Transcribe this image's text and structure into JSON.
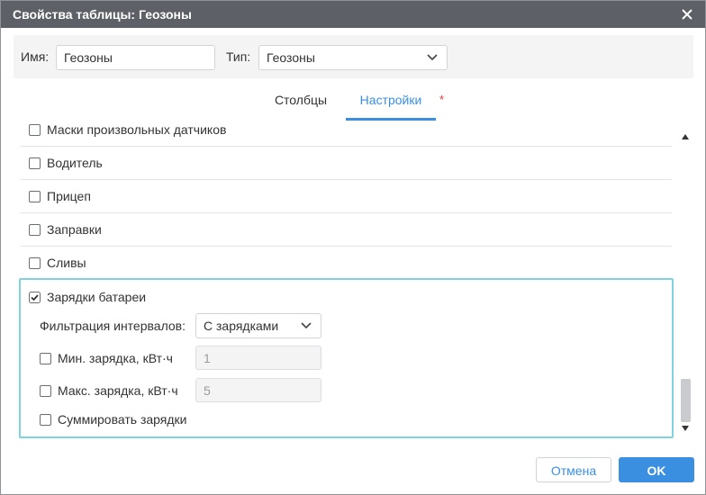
{
  "dialog": {
    "title": "Свойства таблицы: Геозоны",
    "close_icon": "close-icon"
  },
  "header": {
    "name_label": "Имя:",
    "name_value": "Геозоны",
    "type_label": "Тип:",
    "type_value": "Геозоны"
  },
  "tabs": {
    "columns_label": "Столбцы",
    "settings_label": "Настройки",
    "active": "settings",
    "required_marker": "*"
  },
  "rows": [
    {
      "label": "Маски произвольных датчиков",
      "checked": false
    },
    {
      "label": "Водитель",
      "checked": false
    },
    {
      "label": "Прицеп",
      "checked": false
    },
    {
      "label": "Заправки",
      "checked": false
    },
    {
      "label": "Сливы",
      "checked": false
    }
  ],
  "battery": {
    "label": "Зарядки батареи",
    "checked": true,
    "filter_label": "Фильтрация интервалов:",
    "filter_value": "С зарядками",
    "min_label": "Мин. зарядка, кВт·ч",
    "min_checked": false,
    "min_value": "1",
    "max_label": "Макс. зарядка, кВт·ч",
    "max_checked": false,
    "max_value": "5",
    "sum_label": "Суммировать зарядки",
    "sum_checked": false
  },
  "footer": {
    "cancel_label": "Отмена",
    "ok_label": "OK"
  },
  "colors": {
    "accent": "#3b8fe1",
    "titlebar": "#5d6067",
    "highlight_border": "#7fd3dc",
    "required": "#e53935"
  }
}
